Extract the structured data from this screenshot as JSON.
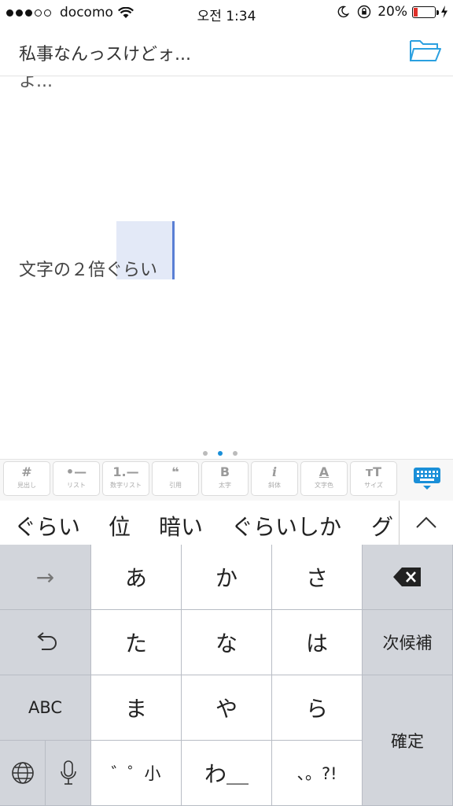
{
  "status_bar": {
    "carrier": "docomo",
    "time": "오전 1:34",
    "battery_percent": "20%",
    "battery_level": 0.2,
    "signal_bars_filled": 3,
    "signal_bars_total": 5
  },
  "header": {
    "title": "私事なんっスけどォ...",
    "folder_icon": "folder-icon",
    "accent": "#2ba0e0"
  },
  "editor": {
    "cut_line": "よ...",
    "line_plain": "文字の２倍",
    "line_selected": "ぐらい"
  },
  "page_indicator": {
    "count": 3,
    "active": 1
  },
  "format_toolbar": {
    "buttons": [
      {
        "icon": "#",
        "label": "見出し"
      },
      {
        "icon": "•—",
        "label": "リスト"
      },
      {
        "icon": "1.—",
        "label": "数字リスト"
      },
      {
        "icon": "❝",
        "label": "引用"
      },
      {
        "icon": "B",
        "label": "太字"
      },
      {
        "icon": "i",
        "label": "斜体"
      },
      {
        "icon": "A",
        "label": "文字色"
      },
      {
        "icon": "тT",
        "label": "サイズ"
      }
    ],
    "keyboard_icon": "keyboard-dismiss-icon"
  },
  "suggestions": [
    "ぐらい",
    "位",
    "暗い",
    "ぐらいしか",
    "グ"
  ],
  "keyboard": {
    "arrow": "→",
    "row1": [
      "あ",
      "か",
      "さ"
    ],
    "row2": [
      "た",
      "な",
      "は"
    ],
    "row3": [
      "ま",
      "や",
      "ら"
    ],
    "row4": [
      "゛゜小",
      "わ＿",
      "、。?!"
    ],
    "undo_icon": "undo-icon",
    "next_candidate": "次候補",
    "abc": "ABC",
    "confirm": "確定",
    "globe_icon": "globe-icon",
    "mic_icon": "microphone-icon",
    "backspace_icon": "backspace-icon"
  }
}
